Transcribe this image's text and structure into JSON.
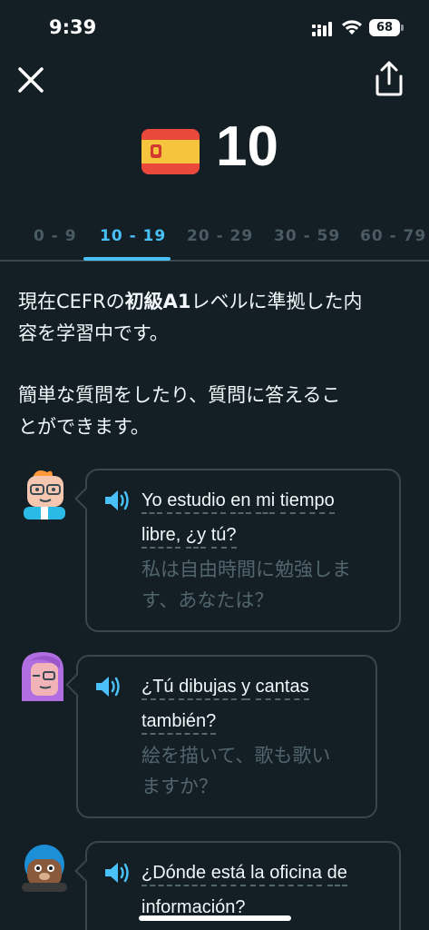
{
  "status_bar": {
    "time": "9:39",
    "battery": "68"
  },
  "header": {
    "score": "10"
  },
  "tabs": [
    "0 - 9",
    "10 - 19",
    "20 - 29",
    "30 - 59",
    "60 - 79"
  ],
  "active_tab": "10 - 19",
  "description": {
    "line1_prefix": "現在CEFRの",
    "line1_bold": "初級A1",
    "line1_suffix": "レベルに準拠した内",
    "line2": "容を学習中です。",
    "para2_line1": "簡単な質問をしたり、質問に答えるこ",
    "para2_line2": "とができます。"
  },
  "dialogues": [
    {
      "es_line1": [
        "Yo",
        "estudio",
        "en",
        "mi",
        "tiempo"
      ],
      "es_line2": [
        "libre,",
        "¿y",
        "tú?"
      ],
      "ja_line1": "私は自由時間に勉強しま",
      "ja_line2": "す、あなたは？"
    },
    {
      "es_line1": [
        "¿Tú",
        "dibujas",
        "y",
        "cantas"
      ],
      "es_line2": [
        "también?"
      ],
      "ja_line1": "絵を描いて、歌も歌い",
      "ja_line2": "ますか？"
    },
    {
      "es_line1": [
        "¿Dónde",
        "está",
        "la",
        "oficina",
        "de"
      ],
      "es_line2": [
        "información?"
      ]
    }
  ],
  "colors": {
    "background": "#131f24",
    "accent": "#49c0f8",
    "border": "#37464f",
    "muted": "#52656d"
  },
  "icons": [
    "close-icon",
    "share-icon",
    "spain-flag-icon",
    "speaker-icon",
    "wifi-icon",
    "signal-icon"
  ]
}
